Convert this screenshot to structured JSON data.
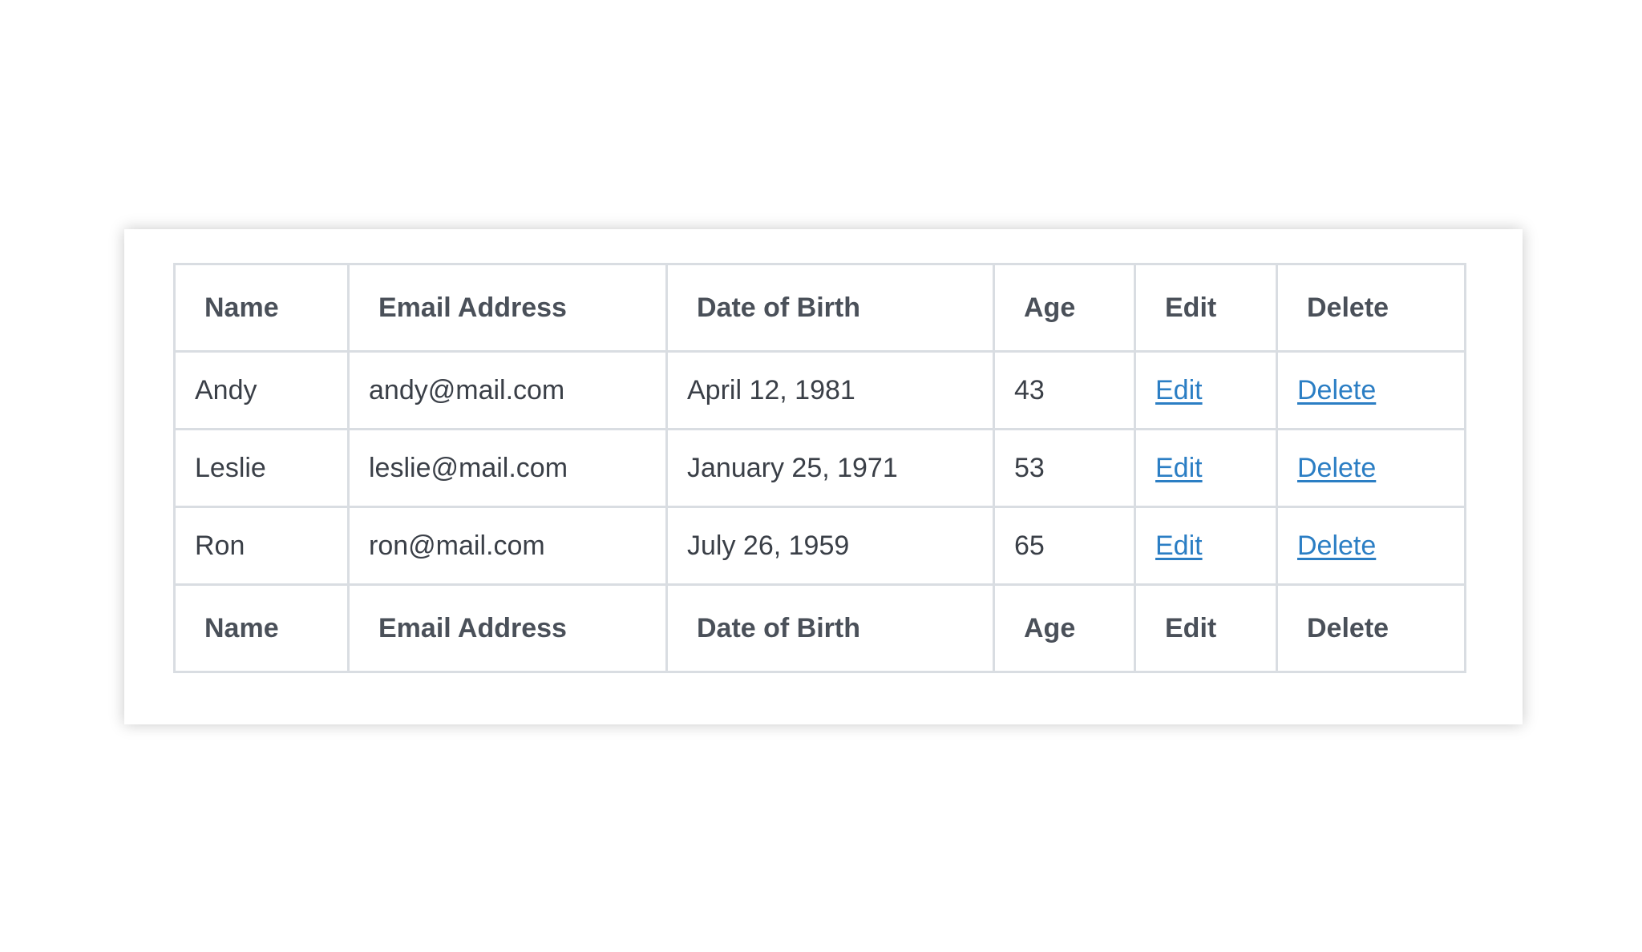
{
  "table": {
    "columns": [
      "Name",
      "Email Address",
      "Date of Birth",
      "Age",
      "Edit",
      "Delete"
    ],
    "rows": [
      {
        "name": "Andy",
        "email": "andy@mail.com",
        "dob": "April 12, 1981",
        "age": "43",
        "edit": "Edit",
        "delete": "Delete"
      },
      {
        "name": "Leslie",
        "email": "leslie@mail.com",
        "dob": "January 25, 1971",
        "age": "53",
        "edit": "Edit",
        "delete": "Delete"
      },
      {
        "name": "Ron",
        "email": "ron@mail.com",
        "dob": "July 26, 1959",
        "age": "65",
        "edit": "Edit",
        "delete": "Delete"
      }
    ],
    "footer": [
      "Name",
      "Email Address",
      "Date of Birth",
      "Age",
      "Edit",
      "Delete"
    ]
  },
  "colors": {
    "border": "#d9dde2",
    "link": "#2b7ec4",
    "text": "#3a3f47",
    "header_text": "#4a5059"
  }
}
